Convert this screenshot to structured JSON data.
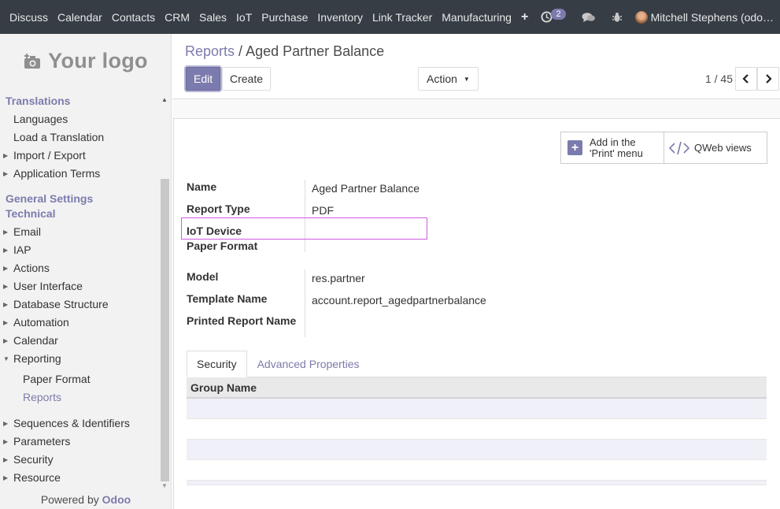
{
  "navbar": {
    "menus": [
      "Discuss",
      "Calendar",
      "Contacts",
      "CRM",
      "Sales",
      "IoT",
      "Purchase",
      "Inventory",
      "Link Tracker",
      "Manufacturing"
    ],
    "plus": "+",
    "activity_count": "2",
    "user": "Mitchell Stephens (odo…"
  },
  "sidebar": {
    "logo": "Your logo",
    "translations_head": "Translations",
    "languages": "Languages",
    "load_translation": "Load a Translation",
    "import_export": "Import / Export",
    "application_terms": "Application Terms",
    "general_settings": "General Settings",
    "technical": "Technical",
    "email": "Email",
    "iap": "IAP",
    "actions": "Actions",
    "user_interface": "User Interface",
    "database_structure": "Database Structure",
    "automation": "Automation",
    "calendar": "Calendar",
    "reporting": "Reporting",
    "paper_format": "Paper Format",
    "reports": "Reports",
    "sequences": "Sequences & Identifiers",
    "parameters": "Parameters",
    "security": "Security",
    "resource": "Resource",
    "powered_by": "Powered by",
    "odoo": "Odoo"
  },
  "control": {
    "breadcrumb_parent": "Reports",
    "breadcrumb_sep": "/",
    "breadcrumb_current": "Aged Partner Balance",
    "edit_label": "Edit",
    "create_label": "Create",
    "action_label": "Action",
    "pager": "1 / 45"
  },
  "buttonbox": {
    "add_print_line1": "Add in the",
    "add_print_line2": "'Print' menu",
    "qweb_views": "QWeb views"
  },
  "form": {
    "name_label": "Name",
    "name_value": "Aged Partner Balance",
    "report_type_label": "Report Type",
    "report_type_value": "PDF",
    "iot_device_label": "IoT Device",
    "paper_format_label": "Paper Format",
    "model_label": "Model",
    "model_value": "res.partner",
    "template_name_label": "Template Name",
    "template_name_value": "account.report_agedpartnerbalance",
    "printed_report_name_label": "Printed Report Name"
  },
  "tabs": {
    "security": "Security",
    "advanced": "Advanced Properties"
  },
  "table": {
    "header": "Group Name"
  },
  "colors": {
    "navbar": "#363d45",
    "accent": "#7c7bad",
    "highlight": "#d05be0"
  }
}
